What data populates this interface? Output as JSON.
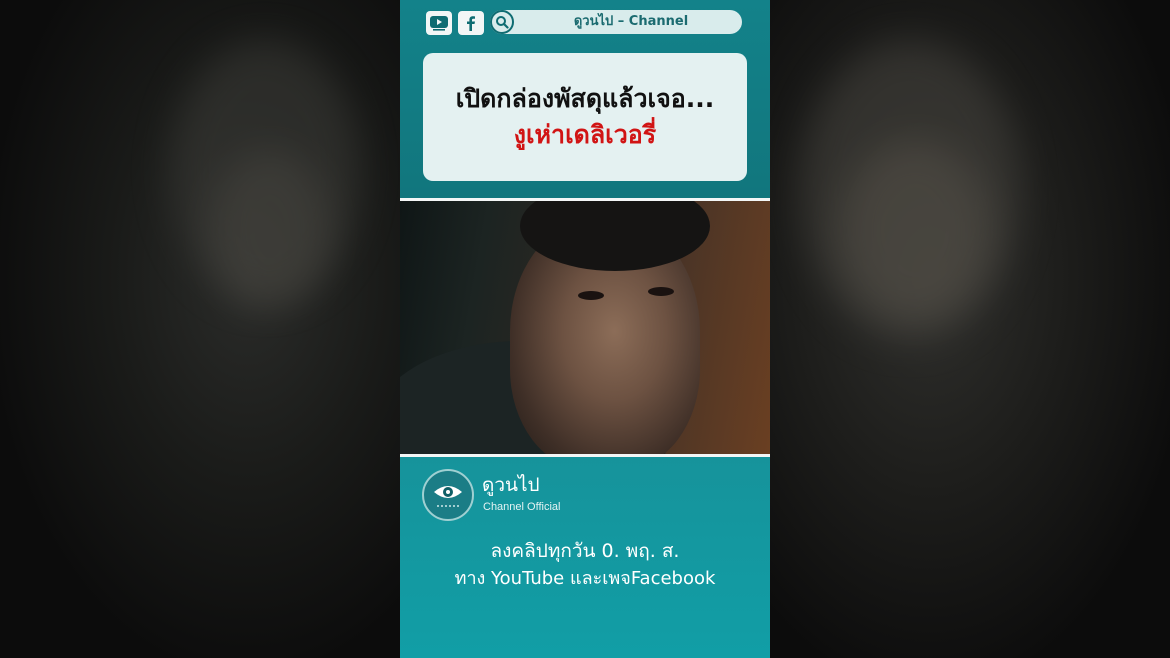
{
  "header": {
    "social_icons": [
      "youtube-icon",
      "facebook-icon"
    ],
    "search_icon": "search-icon",
    "channel_label": "ดูวนไป – Channel"
  },
  "title_card": {
    "line1": "เปิดกล่องพัสดุแล้วเจอ...",
    "line2": "งูเห่าเดลิเวอรี่"
  },
  "video": {
    "description": "movie-still"
  },
  "footer": {
    "brand_name": "ดูวนไป",
    "brand_tagline": "Channel Official",
    "logo_icon": "eye-logo-icon",
    "info_line1": "ลงคลิปทุกวัน 0. พฤ. ส.",
    "info_line2": "ทาง YouTube และเพจFacebook"
  },
  "colors": {
    "teal_dark": "#11767d",
    "teal_light": "#119ea6",
    "card_bg": "#e4f1f1",
    "title_red": "#d11414"
  }
}
